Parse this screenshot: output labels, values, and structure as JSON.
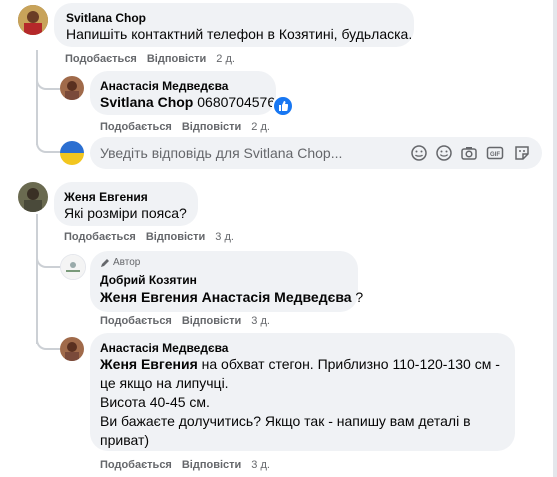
{
  "comments": [
    {
      "author": "Svitlana Chop",
      "text": "Напишіть контактний телефон в Козятині, будьласка.",
      "like": "Подобається",
      "reply": "Відповісти",
      "time": "2 д."
    },
    {
      "author": "Анастасія Медведєва",
      "tag": "Svitlana Chop",
      "text": " 0680704576",
      "like": "Подобається",
      "reply": "Відповісти",
      "time": "2 д."
    },
    {
      "author": "Женя Евгения",
      "text": "Які розміри пояса?",
      "like": "Подобається",
      "reply": "Відповісти",
      "time": "3 д."
    },
    {
      "author_badge": "Автор",
      "author": "Добрий Козятин",
      "tag": "Женя Евгения Анастасія Медведєва",
      "text": " ?",
      "like": "Подобається",
      "reply": "Відповісти",
      "time": "3 д."
    },
    {
      "author": "Анастасія Медведєва",
      "tag": "Женя Евгения",
      "text_line1": " на обхват стегон. Приблизно 110-120-130 см -",
      "text_line2": "це якщо на липучці.",
      "text_line3": "Висота 40-45 см.",
      "text_line4": "Ви бажаєте долучитись? Якщо так - напишу вам деталі в",
      "text_line5": "приват)",
      "like": "Подобається",
      "reply": "Відповісти",
      "time": "3 д."
    }
  ],
  "reply_input": {
    "placeholder": "Уведіть відповідь для Svitlana Chop..."
  },
  "input_icons": [
    "sticker-face-icon",
    "emoji-icon",
    "camera-icon",
    "gif-icon",
    "sticker-icon"
  ],
  "colors": {
    "bubble": "#f0f2f5",
    "meta": "#65676b",
    "like_reaction": "#1877f2",
    "thread_line": "#ccd0d5"
  }
}
